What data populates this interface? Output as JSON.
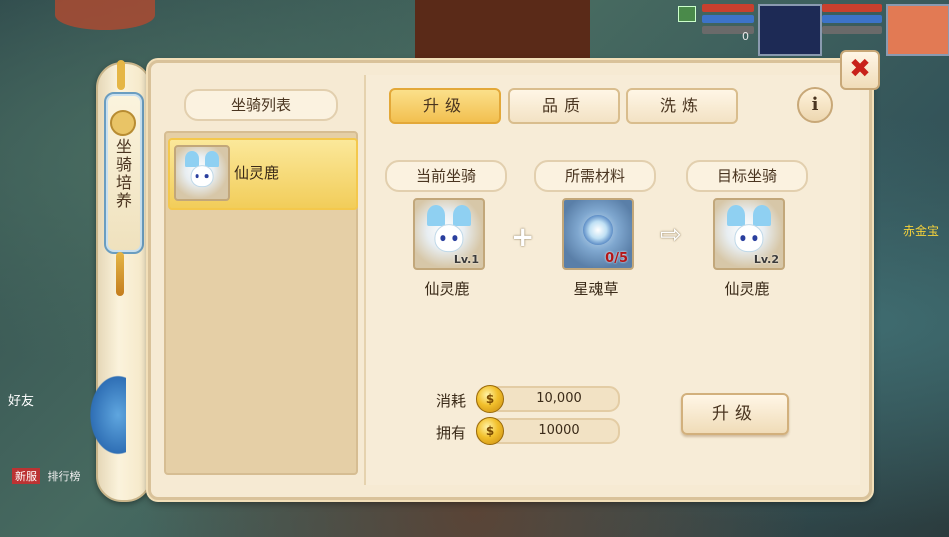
{
  "side_tab": {
    "title": "坐骑培养"
  },
  "mount_list": {
    "header": "坐骑列表",
    "items": [
      {
        "name": "仙灵鹿",
        "selected": true
      }
    ]
  },
  "tabs": [
    {
      "label": "升级",
      "active": true
    },
    {
      "label": "品质",
      "active": false
    },
    {
      "label": "洗炼",
      "active": false
    }
  ],
  "info_button": {
    "label": "i"
  },
  "close_button": {
    "label": "✖"
  },
  "upgrade_section": {
    "current": {
      "header": "当前坐骑",
      "name": "仙灵鹿",
      "level": "Lv.1"
    },
    "material": {
      "header": "所需材料",
      "name": "星魂草",
      "count": "0/5"
    },
    "target": {
      "header": "目标坐骑",
      "name": "仙灵鹿",
      "level": "Lv.2"
    },
    "plus_symbol": "+",
    "arrow_symbol": "⇨"
  },
  "cost": {
    "label": "消耗",
    "value": "10,000"
  },
  "owned": {
    "label": "拥有",
    "value": "10000"
  },
  "upgrade_button": {
    "label": "升级"
  },
  "hud": {
    "counter": "0"
  },
  "background": {
    "chat_name": "好友",
    "rank_label": "排行榜",
    "rank_badge": "新服",
    "npc_name": "赤金宝"
  },
  "colors": {
    "panel_bg": "#f6ead3",
    "active_tab": "#f2c050",
    "close_x": "#c8211a",
    "material_count": "#b51616"
  }
}
